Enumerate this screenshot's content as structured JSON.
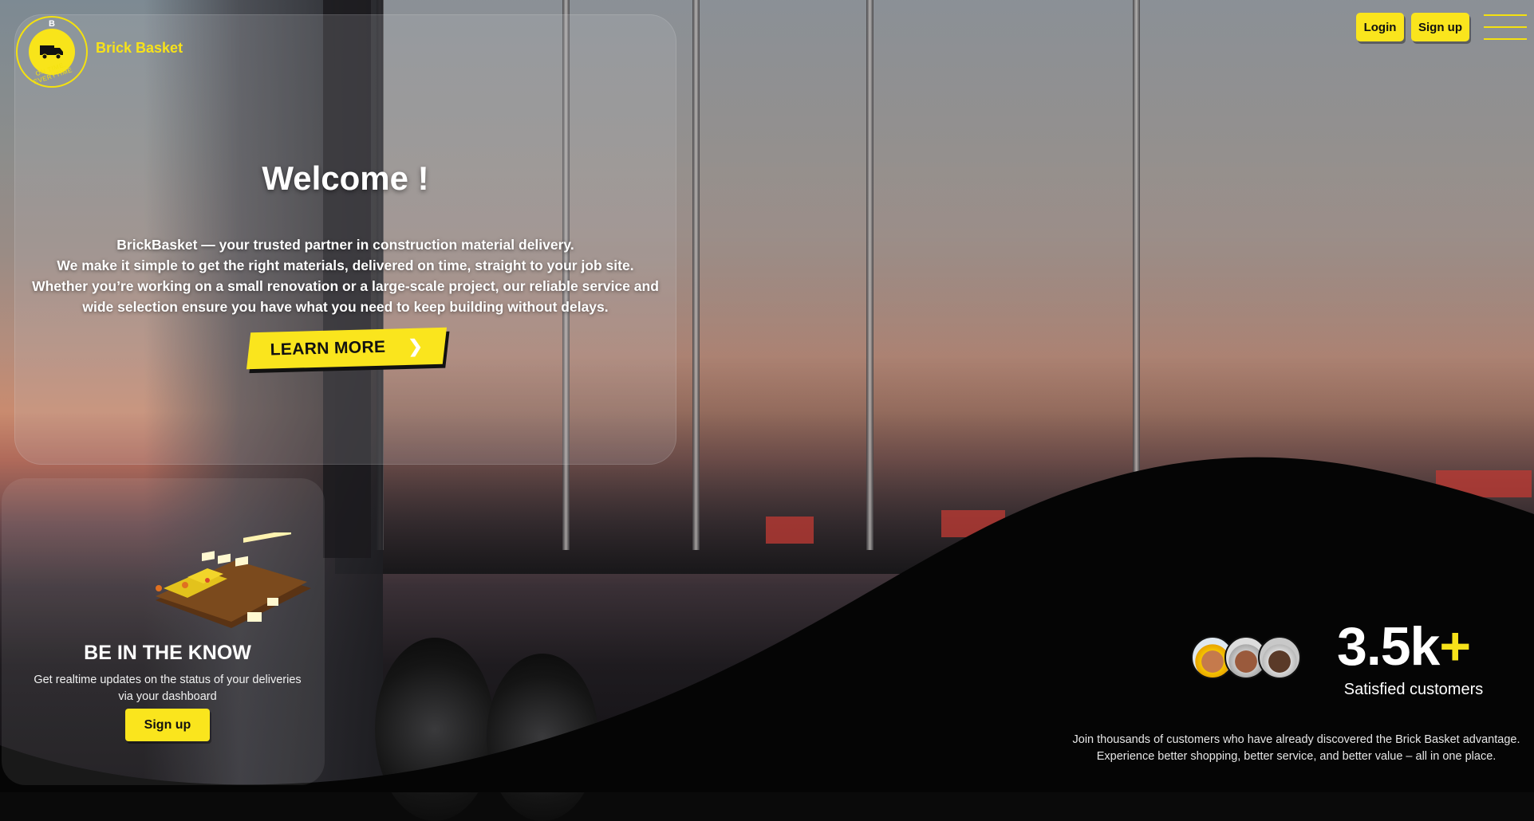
{
  "header": {
    "brand": "Brick Basket",
    "logo_letter": "B",
    "logo_tagline": "ON TIME, EVERYTIME",
    "login_label": "Login",
    "signup_label": "Sign up"
  },
  "hero": {
    "title": "Welcome !",
    "lines": [
      "BrickBasket — your trusted partner in construction material delivery.",
      "We make it simple to get the right materials, delivered on time, straight to your job site.",
      "Whether you’re working on a small renovation or a large-scale project, our reliable service and",
      "wide selection ensure you have what you need to keep building without delays."
    ],
    "cta_label": "LEARN MORE",
    "cta_icon": "chevron-right-icon"
  },
  "know": {
    "title": "BE IN THE KNOW",
    "text_line1": "Get realtime updates on the status of your deliveries",
    "text_line2": "via your dashboard",
    "signup_label": "Sign up"
  },
  "stats": {
    "value": "3.5k",
    "plus": "+",
    "label": "Satisfied customers",
    "join_line1": "Join thousands of customers who have already discovered the Brick Basket advantage.",
    "join_line2": "Experience better shopping, better service, and better value – all in one place."
  },
  "colors": {
    "accent": "#fae51d",
    "dark": "#0a0a0a",
    "text": "#ffffff"
  }
}
